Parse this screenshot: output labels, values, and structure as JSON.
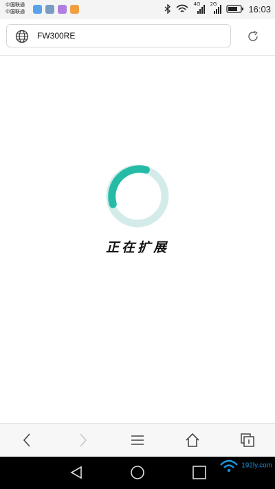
{
  "status_bar": {
    "carrier_line1": "中国联通",
    "carrier_line2": "中国联通",
    "app_icons": [
      {
        "name": "app-icon-1",
        "color": "#5aa3e8"
      },
      {
        "name": "app-icon-2",
        "color": "#7a9cc4"
      },
      {
        "name": "app-icon-3",
        "color": "#b07ee0"
      },
      {
        "name": "app-icon-4",
        "color": "#f0a040"
      }
    ],
    "net1": "4G",
    "net2": "2G",
    "time": "16:03"
  },
  "address_bar": {
    "url": "FW300RE"
  },
  "main": {
    "status_text": "正在扩展",
    "spinner_color": "#26bba7",
    "spinner_track_color": "#d3ecea"
  },
  "watermark": {
    "text": "192ly.com"
  }
}
